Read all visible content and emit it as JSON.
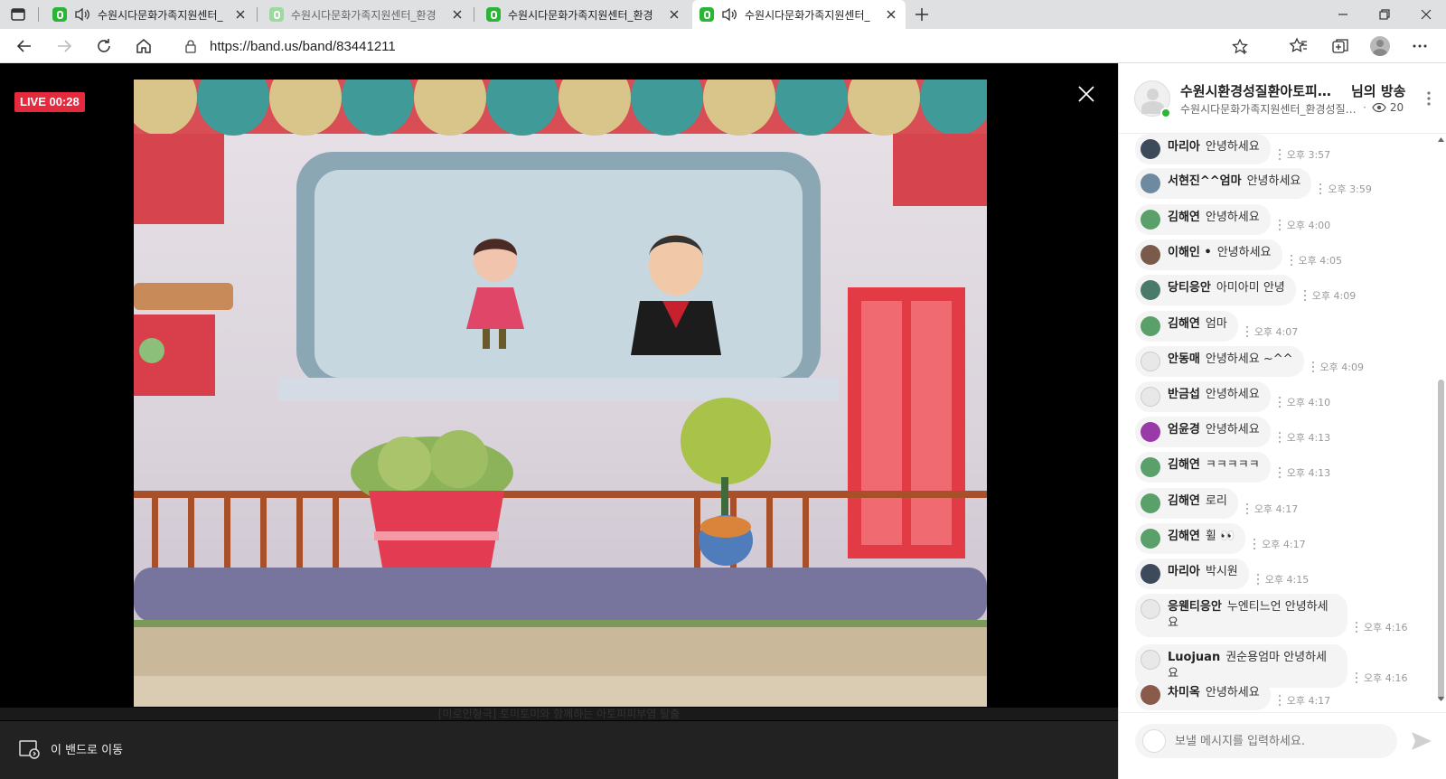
{
  "browser": {
    "tabs": [
      {
        "title": "수원시다문화가족지원센터_",
        "audio": true,
        "active": false,
        "dim": false
      },
      {
        "title": "수원시다문화가족지원센터_환경",
        "audio": false,
        "active": false,
        "dim": true
      },
      {
        "title": "수원시다문화가족지원센터_환경",
        "audio": false,
        "active": false,
        "dim": false
      },
      {
        "title": "수원시다문화가족지원센터_",
        "audio": true,
        "active": true,
        "dim": false
      }
    ],
    "url": "https://band.us/band/83441211"
  },
  "video": {
    "live_label": "LIVE 00:28",
    "caption": "[미로인형극] 토미토미와 함께하는 아토피피부염 탈출",
    "goto_band_label": "이 밴드로 이동"
  },
  "chat": {
    "host_name": "수원시환경성질환아토피센터",
    "host_suffix": "님의 방송",
    "band_name": "수원시다문화가족지원센터_환경성질환아토피센터",
    "viewer_count": "20",
    "input_placeholder": "보낼 메시지를 입력하세요.",
    "messages": [
      {
        "nick": "마리아",
        "text": "안녕하세요",
        "time": "오후 3:57",
        "avatar": "#3d4a5c"
      },
      {
        "nick": "서현진^^엄마",
        "text": "안녕하세요",
        "time": "오후 3:59",
        "avatar": "#6f8aa0"
      },
      {
        "nick": "김해연",
        "text": "안녕하세요",
        "time": "오후 4:00",
        "avatar": "#5aa06a"
      },
      {
        "nick": "이해인 •",
        "text": "안녕하세요",
        "time": "오후 4:05",
        "avatar": "#7a5a4a"
      },
      {
        "nick": "당티응안",
        "text": "아미아미 안녕",
        "time": "오후 4:09",
        "avatar": "#4a7a6a"
      },
      {
        "nick": "김해연",
        "text": "엄마",
        "time": "오후 4:07",
        "avatar": "#5aa06a"
      },
      {
        "nick": "안동매",
        "text": "안녕하세요 ~^^",
        "time": "오후 4:09",
        "avatar": "#e8e8e8"
      },
      {
        "nick": "반금섭",
        "text": "안녕하세요",
        "time": "오후 4:10",
        "avatar": "#e8e8e8"
      },
      {
        "nick": "엄윤경",
        "text": "안녕하세요",
        "time": "오후 4:13",
        "avatar": "#9a3aa8"
      },
      {
        "nick": "김해연",
        "text": "ㅋㅋㅋㅋㅋ",
        "time": "오후 4:13",
        "avatar": "#5aa06a"
      },
      {
        "nick": "김해연",
        "text": "로리",
        "time": "오후 4:17",
        "avatar": "#5aa06a"
      },
      {
        "nick": "김해연",
        "text": "휠 👀",
        "time": "오후 4:17",
        "avatar": "#5aa06a"
      },
      {
        "nick": "마리아",
        "text": "박시원",
        "time": "오후 4:15",
        "avatar": "#3d4a5c"
      },
      {
        "nick": "응웬티응안",
        "text": "누엔티느언 안녕하세요",
        "time": "오후 4:16",
        "avatar": "#e8e8e8"
      },
      {
        "nick": "Luojuan",
        "text": "권순용엄마 안녕하세요",
        "time": "오후 4:16",
        "avatar": "#e8e8e8"
      },
      {
        "nick": "차미옥",
        "text": "안녕하세요",
        "time": "오후 4:17",
        "avatar": "#8a5a4a"
      }
    ]
  }
}
